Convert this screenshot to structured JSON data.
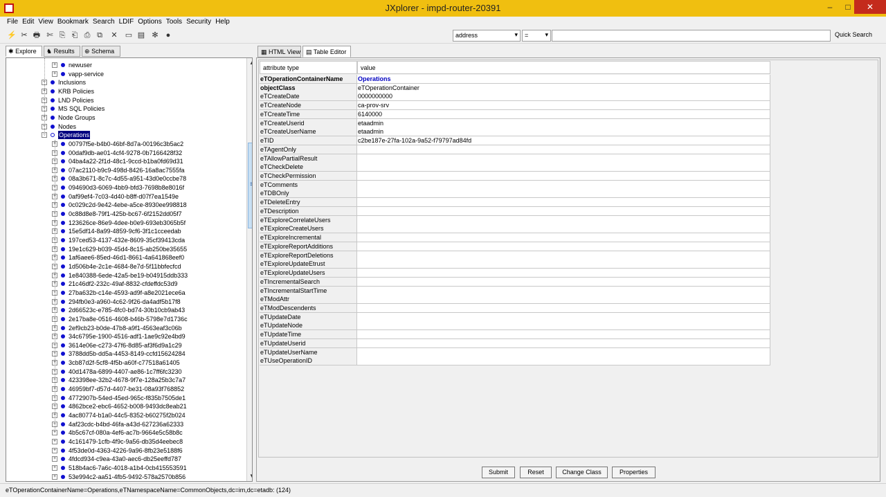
{
  "window": {
    "title": "JXplorer - impd-router-20391",
    "minimize": "–",
    "maximize": "□",
    "close": "✕"
  },
  "menu": [
    "File",
    "Edit",
    "View",
    "Bookmark",
    "Search",
    "LDIF",
    "Options",
    "Tools",
    "Security",
    "Help"
  ],
  "toolbar": {
    "icons": [
      "connect-icon",
      "disconnect-icon",
      "print-icon",
      "cut-icon",
      "copy-icon",
      "copy-dn-icon",
      "paste-icon",
      "paste-alias-icon",
      "delete-icon",
      "new-entry-icon",
      "rename-icon",
      "refresh-icon",
      "stop-icon"
    ],
    "glyphs": [
      "⚡",
      "✂",
      "🖶",
      "✄",
      "⎘",
      "⎗",
      "⎙",
      "⧉",
      "✕",
      "▭",
      "▤",
      "✻",
      "●"
    ],
    "search_attribute": "address",
    "search_operator": "=",
    "search_value": "",
    "quick_search": "Quick Search"
  },
  "left_tabs": [
    {
      "label": "Explore",
      "icon": "✱"
    },
    {
      "label": "Results",
      "icon": "♞"
    },
    {
      "label": "Schema",
      "icon": "⊕"
    }
  ],
  "tree": {
    "above": [
      {
        "label": "newuser",
        "level": 2
      },
      {
        "label": "vapp-service",
        "level": 2
      }
    ],
    "groups": [
      "Inclusions",
      "KRB Policies",
      "LND Policies",
      "MS SQL Policies",
      "Node Groups",
      "Nodes",
      "Operations"
    ],
    "selected": "Operations",
    "children": [
      "00797f5e-b4b0-46bf-8d7a-00196c3b5ac2",
      "00daf9db-ae01-4cf4-9278-0b7166428f32",
      "04ba4a22-2f1d-48c1-9ccd-b1ba0fd69d31",
      "07ac2110-b9c9-498d-8426-16a8ac7555fa",
      "08a3b671-8c7c-4d55-a951-43d0e0ccbe78",
      "094690d3-6069-4bb9-bfd3-7698b8e8016f",
      "0af99ef4-7c03-4d40-b8ff-d07f7ea1549e",
      "0c029c2d-9e42-4ebe-a5ce-8930ee998818",
      "0c88d8e8-79f1-425b-bc67-6f2152dd05f7",
      "123626ce-86e9-4dee-b0e9-693eb3065b5f",
      "15e5df14-8a99-4859-9cf6-3f1c1cceedab",
      "197ced53-4137-432e-8609-35cf39413cda",
      "19e1c629-b039-45d4-8c15-ab250be35655",
      "1af6aee6-85ed-46d1-8661-4a641868eef0",
      "1d506b4e-2c1e-4684-8e7d-5f11bbfecfcd",
      "1e840388-6ede-42a5-be19-b04915ddb333",
      "21c46df2-232c-49af-8832-cfdeffdc53d9",
      "27ba632b-c14e-4593-ad9f-a8e2021ece6a",
      "294fb0e3-a960-4c62-9f26-da4adf5b17f8",
      "2d66523c-e785-4fc0-bd74-30b10cb9ab43",
      "2e17ba8e-0516-4608-b46b-5798e7d1736c",
      "2ef9cb23-b0de-47b8-a9f1-4563eaf3c06b",
      "34c6795e-1900-4516-adf1-1ae9c92e4bd9",
      "3614e06e-c273-47f6-8d85-af3f6d9a1c29",
      "3788dd5b-dd5a-4453-8149-ccfd15624284",
      "3cb87d2f-5cf8-4f5b-a60f-c77518a61405",
      "40d1478a-6899-4407-ae86-1c7ff6fc3230",
      "423398ee-32b2-4678-9f7e-128a25b3c7a7",
      "46959bf7-d57d-4407-be31-08a93f768852",
      "4772907b-54ed-45ed-965c-f835b7505de1",
      "4862bce2-ebc6-4652-b008-9493dc8eab21",
      "4ac80774-b1a0-44c5-8352-b60275f2b024",
      "4af23cdc-b4bd-46fa-a43d-627236a62333",
      "4b5c67cf-080a-4ef6-ac7b-9664e5c58b8c",
      "4c161479-1cfb-4f9c-9a56-db35d4eebec8",
      "4f53de0d-4363-4226-9a96-8fb23e5188f6",
      "4fdcd934-c9ea-43a0-aec6-db25eeffd787",
      "518b4ac6-7a6c-4018-a1b4-0cb415553591",
      "53e994c2-aa51-4fb5-9492-578a2570b856"
    ]
  },
  "right_tabs": [
    {
      "label": "HTML View",
      "icon": "▦"
    },
    {
      "label": "Table Editor",
      "icon": "▤"
    }
  ],
  "table": {
    "headers": [
      "attribute type",
      "value"
    ],
    "rows": [
      {
        "attr": "eTOperationContainerName",
        "value": "Operations",
        "bold": true,
        "blue": true
      },
      {
        "attr": "objectClass",
        "value": "eTOperationContainer",
        "bold": true,
        "blue": false
      },
      {
        "attr": "eTCreateDate",
        "value": "0000000000"
      },
      {
        "attr": "eTCreateNode",
        "value": "ca-prov-srv"
      },
      {
        "attr": "eTCreateTime",
        "value": "6140000"
      },
      {
        "attr": "eTCreateUserid",
        "value": "etaadmin"
      },
      {
        "attr": "eTCreateUserName",
        "value": "etaadmin"
      },
      {
        "attr": "eTID",
        "value": "c2be187e-27fa-102a-9a52-f79797ad84fd"
      },
      {
        "attr": "eTAgentOnly",
        "value": ""
      },
      {
        "attr": "eTAllowPartialResult",
        "value": ""
      },
      {
        "attr": "eTCheckDelete",
        "value": ""
      },
      {
        "attr": "eTCheckPermission",
        "value": ""
      },
      {
        "attr": "eTComments",
        "value": ""
      },
      {
        "attr": "eTDBOnly",
        "value": ""
      },
      {
        "attr": "eTDeleteEntry",
        "value": ""
      },
      {
        "attr": "eTDescription",
        "value": ""
      },
      {
        "attr": "eTExploreCorrelateUsers",
        "value": ""
      },
      {
        "attr": "eTExploreCreateUsers",
        "value": ""
      },
      {
        "attr": "eTExploreIncremental",
        "value": ""
      },
      {
        "attr": "eTExploreReportAdditions",
        "value": ""
      },
      {
        "attr": "eTExploreReportDeletions",
        "value": ""
      },
      {
        "attr": "eTExploreUpdateEtrust",
        "value": ""
      },
      {
        "attr": "eTExploreUpdateUsers",
        "value": ""
      },
      {
        "attr": "eTIncrementalSearch",
        "value": ""
      },
      {
        "attr": "eTIncrementalStartTime",
        "value": ""
      },
      {
        "attr": "eTModAttr",
        "value": ""
      },
      {
        "attr": "eTModDescendents",
        "value": ""
      },
      {
        "attr": "eTUpdateDate",
        "value": ""
      },
      {
        "attr": "eTUpdateNode",
        "value": ""
      },
      {
        "attr": "eTUpdateTime",
        "value": ""
      },
      {
        "attr": "eTUpdateUserid",
        "value": ""
      },
      {
        "attr": "eTUpdateUserName",
        "value": ""
      },
      {
        "attr": "eTUseOperationID",
        "value": ""
      }
    ]
  },
  "buttons": [
    "Submit",
    "Reset",
    "Change Class",
    "Properties"
  ],
  "status": "eTOperationContainerName=Operations,eTNamespaceName=CommonObjects,dc=im,dc=etadb: (124)"
}
